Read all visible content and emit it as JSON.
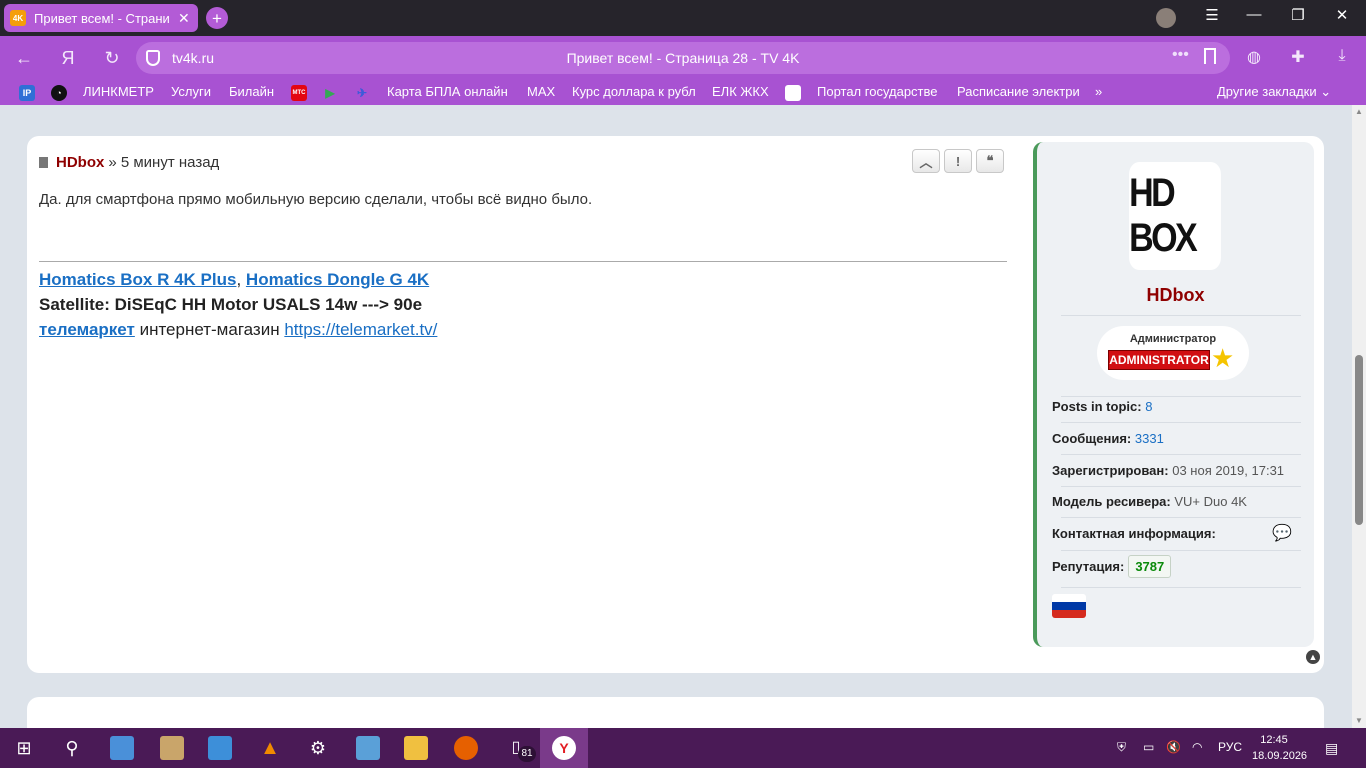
{
  "browser": {
    "tab_favicon": "4K",
    "tab_title": "Привет всем! - Страни",
    "omnibox_domain": "tv4k.ru",
    "omnibox_title": "Привет всем! - Страница 28 - TV 4K",
    "other_bookmarks": "Другие закладки",
    "bookmarks": [
      "ЛИНКМЕТР",
      "Услуги",
      "Билайн",
      "Карта БПЛА онлайн",
      "MAX",
      "Курс доллара к рубл",
      "ЕЛК ЖКХ",
      "Портал государстве",
      "Расписание электри"
    ],
    "bookmark_icons": {
      "ip": "IP",
      "mts": "МТС"
    }
  },
  "post": {
    "author": "HDbox",
    "time": "» 5 минут назад",
    "buttons": {
      "up": "︿",
      "report": "!",
      "quote": "❝"
    },
    "text": "Да. для смартфона прямо мобильную версию сделали, чтобы всё видно было.",
    "signature": {
      "link1": "Homatics Box R 4K Plus",
      "sep": ",",
      "link2": "Homatics Dongle G 4K",
      "line2": "Satellite: DiSEqC HH Motor USALS 14w ---> 90e",
      "link3": "телемаркет",
      "line3_text": " интернет-магазин ",
      "url": "https://telemarket.tv/"
    }
  },
  "profile": {
    "logo_text": "HD BOX",
    "name": "HDbox",
    "rank_title": "Администратор",
    "rank_badge": "ADMINISTRATOR",
    "posts_in_topic_label": "Posts in topic:",
    "posts_in_topic": "8",
    "messages_label": "Сообщения:",
    "messages": "3331",
    "registered_label": "Зарегистрирован:",
    "registered": "03 ноя 2019, 17:31",
    "receiver_label": "Модель ресивера:",
    "receiver": "VU+ Duo 4K",
    "contact_label": "Контактная информация:",
    "reputation_label": "Репутация:",
    "reputation": "3787"
  },
  "taskbar": {
    "battery_badge": "81",
    "lang": "РУС",
    "time": "12:45",
    "date": "18.09.2026"
  },
  "colors": {
    "browser_accent": "#a852d2",
    "author": "#8f0000",
    "link": "#1a6fc4",
    "taskbar": "#4a1a56"
  }
}
